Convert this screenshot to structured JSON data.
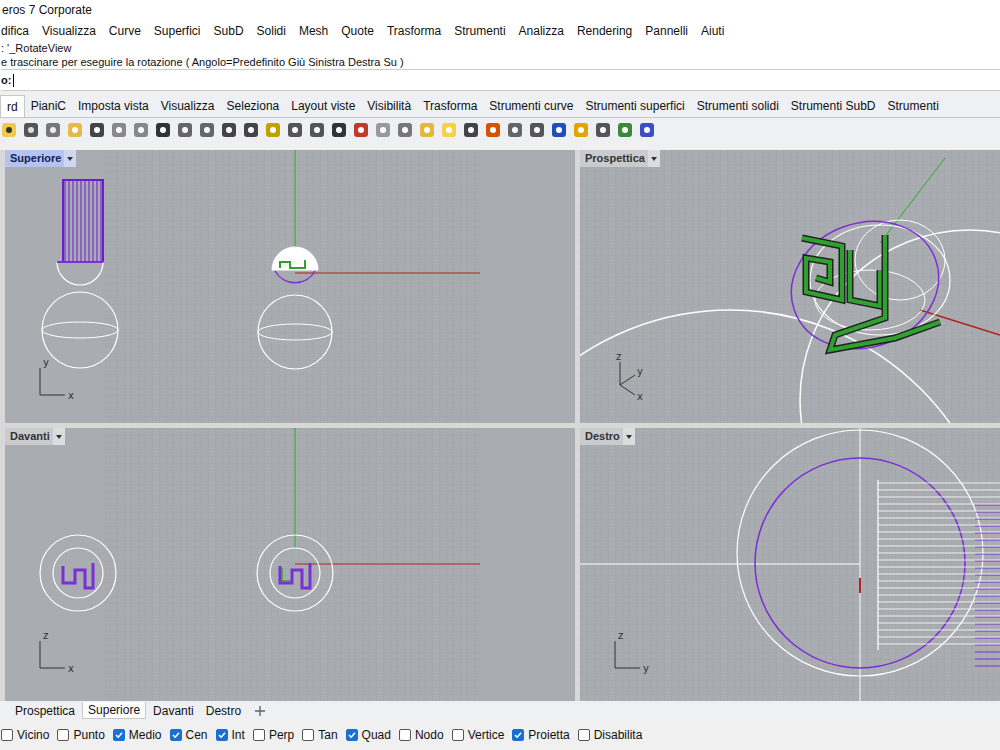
{
  "window": {
    "title": "eros 7 Corporate"
  },
  "menu": [
    "difica",
    "Visualizza",
    "Curve",
    "Superfici",
    "SubD",
    "Solidi",
    "Mesh",
    "Quote",
    "Trasforma",
    "Strumenti",
    "Analizza",
    "Rendering",
    "Pannelli",
    "Aiuti"
  ],
  "command": {
    "history": [
      ": '_RotateView",
      "e trascinare per eseguire la rotazione ( Angolo=Predefinito  Giù  Sinistra  Destra  Su )"
    ],
    "prompt": "o:"
  },
  "tabs": [
    {
      "label": "rd",
      "selected": true
    },
    {
      "label": "PianiC",
      "selected": false
    },
    {
      "label": "Imposta vista",
      "selected": false
    },
    {
      "label": "Visualizza",
      "selected": false
    },
    {
      "label": "Seleziona",
      "selected": false
    },
    {
      "label": "Layout viste",
      "selected": false
    },
    {
      "label": "Visibilità",
      "selected": false
    },
    {
      "label": "Trasforma",
      "selected": false
    },
    {
      "label": "Strumenti curve",
      "selected": false
    },
    {
      "label": "Strumenti superfici",
      "selected": false
    },
    {
      "label": "Strumenti solidi",
      "selected": false
    },
    {
      "label": "Strumenti SubD",
      "selected": false
    },
    {
      "label": "Strumenti",
      "selected": false
    }
  ],
  "viewports": [
    {
      "title": "Superiore",
      "kind": "top",
      "active": true,
      "axes": [
        "y",
        "x"
      ]
    },
    {
      "title": "Prospettica",
      "kind": "perspective",
      "active": false,
      "axes": [
        "z",
        "y",
        "x"
      ]
    },
    {
      "title": "Davanti",
      "kind": "front",
      "active": false,
      "axes": [
        "z",
        "x"
      ]
    },
    {
      "title": "Destro",
      "kind": "right",
      "active": false,
      "axes": [
        "z",
        "y"
      ]
    }
  ],
  "viewport_tabs": [
    {
      "label": "Prospettica",
      "selected": false
    },
    {
      "label": "Superiore",
      "selected": true
    },
    {
      "label": "Davanti",
      "selected": false
    },
    {
      "label": "Destro",
      "selected": false
    }
  ],
  "osnaps": [
    {
      "label": "Vicino",
      "checked": false
    },
    {
      "label": "Punto",
      "checked": false
    },
    {
      "label": "Medio",
      "checked": true
    },
    {
      "label": "Cen",
      "checked": true
    },
    {
      "label": "Int",
      "checked": true
    },
    {
      "label": "Perp",
      "checked": false
    },
    {
      "label": "Tan",
      "checked": false
    },
    {
      "label": "Quad",
      "checked": true
    },
    {
      "label": "Nodo",
      "checked": false
    },
    {
      "label": "Vertice",
      "checked": false
    },
    {
      "label": "Proietta",
      "checked": true
    },
    {
      "label": "Disabilita",
      "checked": false
    }
  ]
}
